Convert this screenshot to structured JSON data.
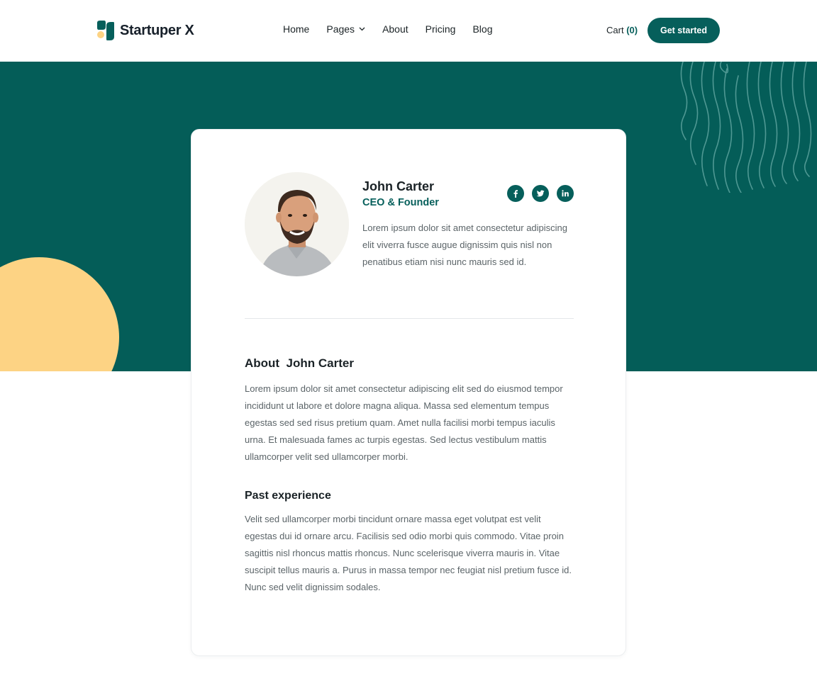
{
  "brand": {
    "name": "Startuper X",
    "primary_color": "#065f5b",
    "accent_color": "#fdd384",
    "logo_icon": "leaf-logo-icon"
  },
  "nav": {
    "items": [
      "Home",
      "Pages",
      "About",
      "Pricing",
      "Blog"
    ],
    "pages_dropdown_icon": "chevron-down-icon"
  },
  "cart": {
    "label": "Cart",
    "count": "(0)"
  },
  "cta": {
    "label": "Get started"
  },
  "profile": {
    "name": "John Carter",
    "role": "CEO & Founder",
    "bio": "Lorem ipsum dolor sit amet consectetur adipiscing elit viverra fusce augue dignissim quis nisl non penatibus etiam nisi nunc mauris sed id.",
    "socials": [
      "facebook-icon",
      "twitter-icon",
      "linkedin-icon"
    ]
  },
  "about": {
    "title": "About  John Carter",
    "text": "Lorem ipsum dolor sit amet consectetur adipiscing elit sed do eiusmod tempor incididunt ut labore et dolore magna aliqua. Massa sed elementum tempus egestas sed sed risus pretium quam. Amet nulla facilisi morbi tempus iaculis urna. Et malesuada fames ac turpis egestas. Sed lectus vestibulum mattis ullamcorper velit sed ullamcorper morbi."
  },
  "experience": {
    "title": "Past experience",
    "text": "Velit sed ullamcorper morbi tincidunt ornare massa eget volutpat est velit egestas dui id ornare arcu. Facilisis sed odio morbi quis commodo. Vitae proin sagittis nisl rhoncus mattis rhoncus. Nunc scelerisque viverra mauris in. Vitae suscipit tellus mauris a. Purus in massa tempor nec feugiat nisl pretium fusce id. Nunc sed velit dignissim sodales."
  }
}
